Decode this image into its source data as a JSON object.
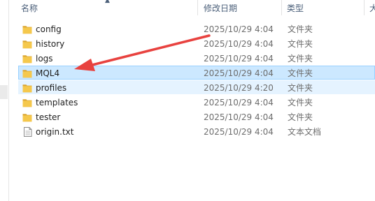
{
  "columns": {
    "name": "名称",
    "modified": "修改日期",
    "type": "类型",
    "size": "大"
  },
  "files": [
    {
      "name": "config",
      "date": "2025/10/29 4:04",
      "type": "文件夹",
      "icon": "folder-icon",
      "state": "normal"
    },
    {
      "name": "history",
      "date": "2025/10/29 4:04",
      "type": "文件夹",
      "icon": "folder-icon",
      "state": "normal"
    },
    {
      "name": "logs",
      "date": "2025/10/29 4:04",
      "type": "文件夹",
      "icon": "folder-icon",
      "state": "normal"
    },
    {
      "name": "MQL4",
      "date": "2025/10/29 4:04",
      "type": "文件夹",
      "icon": "folder-icon",
      "state": "selected"
    },
    {
      "name": "profiles",
      "date": "2025/10/29 4:20",
      "type": "文件夹",
      "icon": "folder-icon",
      "state": "hovered"
    },
    {
      "name": "templates",
      "date": "2025/10/29 4:04",
      "type": "文件夹",
      "icon": "folder-icon",
      "state": "normal"
    },
    {
      "name": "tester",
      "date": "2025/10/29 4:04",
      "type": "文件夹",
      "icon": "folder-icon",
      "state": "normal"
    },
    {
      "name": "origin.txt",
      "date": "2025/10/29 4:04",
      "type": "文本文档",
      "icon": "text-file-icon",
      "state": "normal"
    }
  ],
  "colors": {
    "selected_bg": "#cce8ff",
    "selected_border": "#99d1ff",
    "hover_bg": "#e5f3ff",
    "annotation_arrow": "#e8423f",
    "folder": "#f2c350"
  }
}
